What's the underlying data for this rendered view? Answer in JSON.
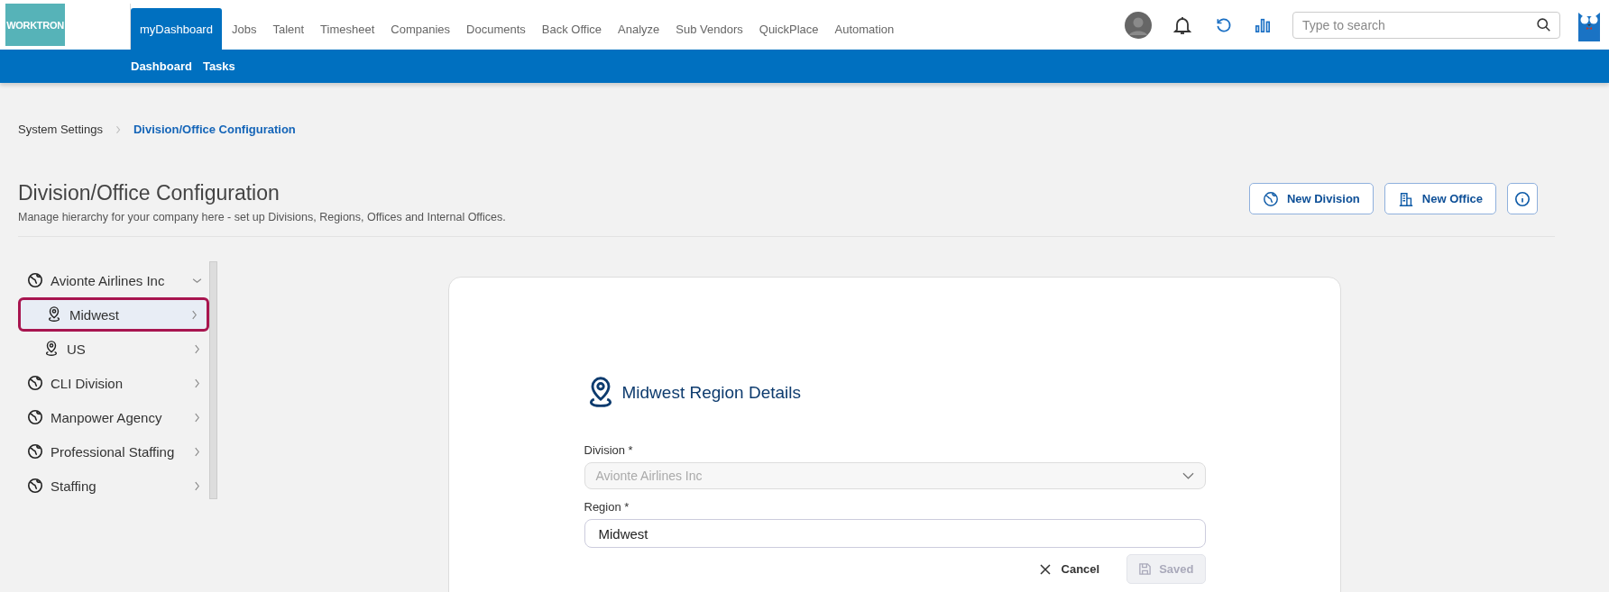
{
  "header": {
    "logo": "WORKTRON",
    "nav": [
      {
        "label": "myDashboard",
        "selected": true
      },
      {
        "label": "Jobs",
        "selected": false
      },
      {
        "label": "Talent",
        "selected": false
      },
      {
        "label": "Timesheet",
        "selected": false
      },
      {
        "label": "Companies",
        "selected": false
      },
      {
        "label": "Documents",
        "selected": false
      },
      {
        "label": "Back Office",
        "selected": false
      },
      {
        "label": "Analyze",
        "selected": false
      },
      {
        "label": "Sub Vendors",
        "selected": false
      },
      {
        "label": "QuickPlace",
        "selected": false
      },
      {
        "label": "Automation",
        "selected": false
      }
    ],
    "search": {
      "placeholder": "Type to search"
    },
    "subnav": [
      "Dashboard",
      "Tasks"
    ]
  },
  "breadcrumb": [
    {
      "label": "System Settings",
      "selected": false
    },
    {
      "label": "Division/Office Configuration",
      "selected": true
    }
  ],
  "page": {
    "title": "Division/Office Configuration",
    "subtitle": "Manage hierarchy for your company here - set up Divisions, Regions, Offices and Internal Offices.",
    "buttons": [
      {
        "kind": "division",
        "label": "New Division"
      },
      {
        "kind": "office",
        "label": "New Office"
      },
      {
        "kind": "info"
      }
    ]
  },
  "tree": [
    {
      "label": "Avionte Airlines Inc",
      "kind": "division",
      "expanded": true,
      "selected": false,
      "children": [
        {
          "label": "Midwest",
          "kind": "region",
          "expanded": false,
          "selected": true
        },
        {
          "label": "US",
          "kind": "region",
          "expanded": false,
          "selected": false
        }
      ]
    },
    {
      "label": "CLI Division",
      "kind": "division",
      "expanded": false,
      "selected": false
    },
    {
      "label": "Manpower Agency",
      "kind": "division",
      "expanded": false,
      "selected": false
    },
    {
      "label": "Professional Staffing",
      "kind": "division",
      "expanded": false,
      "selected": false
    },
    {
      "label": "Staffing",
      "kind": "division",
      "expanded": false,
      "selected": false
    }
  ],
  "details": {
    "title": "Midwest Region Details",
    "division": {
      "label": "Division *",
      "value": "Avionte Airlines Inc",
      "disabled": true
    },
    "region": {
      "label": "Region *",
      "value": "Midwest"
    },
    "cancel": "Cancel",
    "save": {
      "label": "Saved",
      "disabled": true
    }
  }
}
